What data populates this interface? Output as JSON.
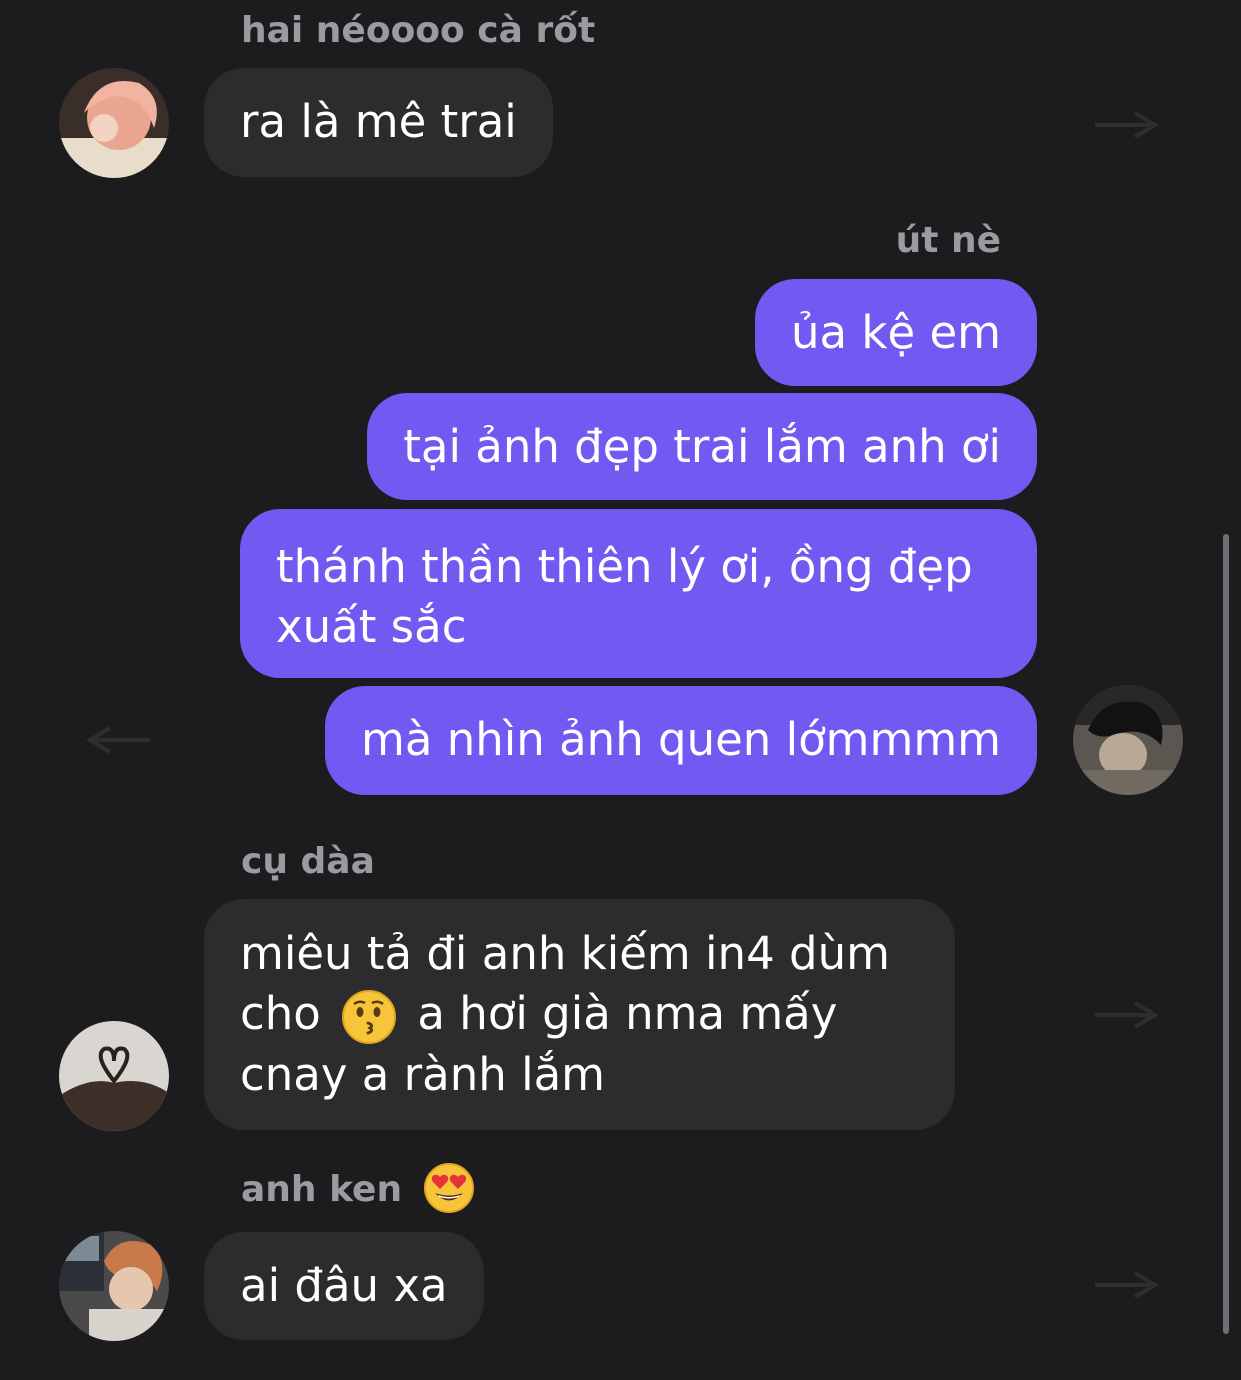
{
  "messages": [
    {
      "sender": "hai néoooo cà rốt",
      "text": "ra là mê trai",
      "direction": "incoming"
    },
    {
      "sender": "út nè",
      "direction": "outgoing",
      "texts": [
        "ủa kệ em",
        "tại ảnh đẹp trai lắm anh ơi",
        "thánh thần thiên lý ơi, ồng đẹp xuất sắc",
        "mà nhìn ảnh quen lớmmmm"
      ]
    },
    {
      "sender": "cụ dàa",
      "direction": "incoming",
      "text_part1": "miêu tả đi anh kiếm in4 dùm cho",
      "text_part2": "a hơi già nma mấy cnay a rành lắm"
    },
    {
      "sender": "anh ken",
      "text": "ai đâu xa",
      "direction": "incoming"
    }
  ],
  "sender_ut": "út nè",
  "colors": {
    "background": "#1c1c1e",
    "incoming_bubble": "#2c2c2e",
    "outgoing_bubble": "#7359f2",
    "sender_name": "#9a9a9f"
  },
  "icons": {
    "kiss_emoji": "kissing-face-icon",
    "heart_eyes_emoji": "heart-eyes-icon"
  }
}
